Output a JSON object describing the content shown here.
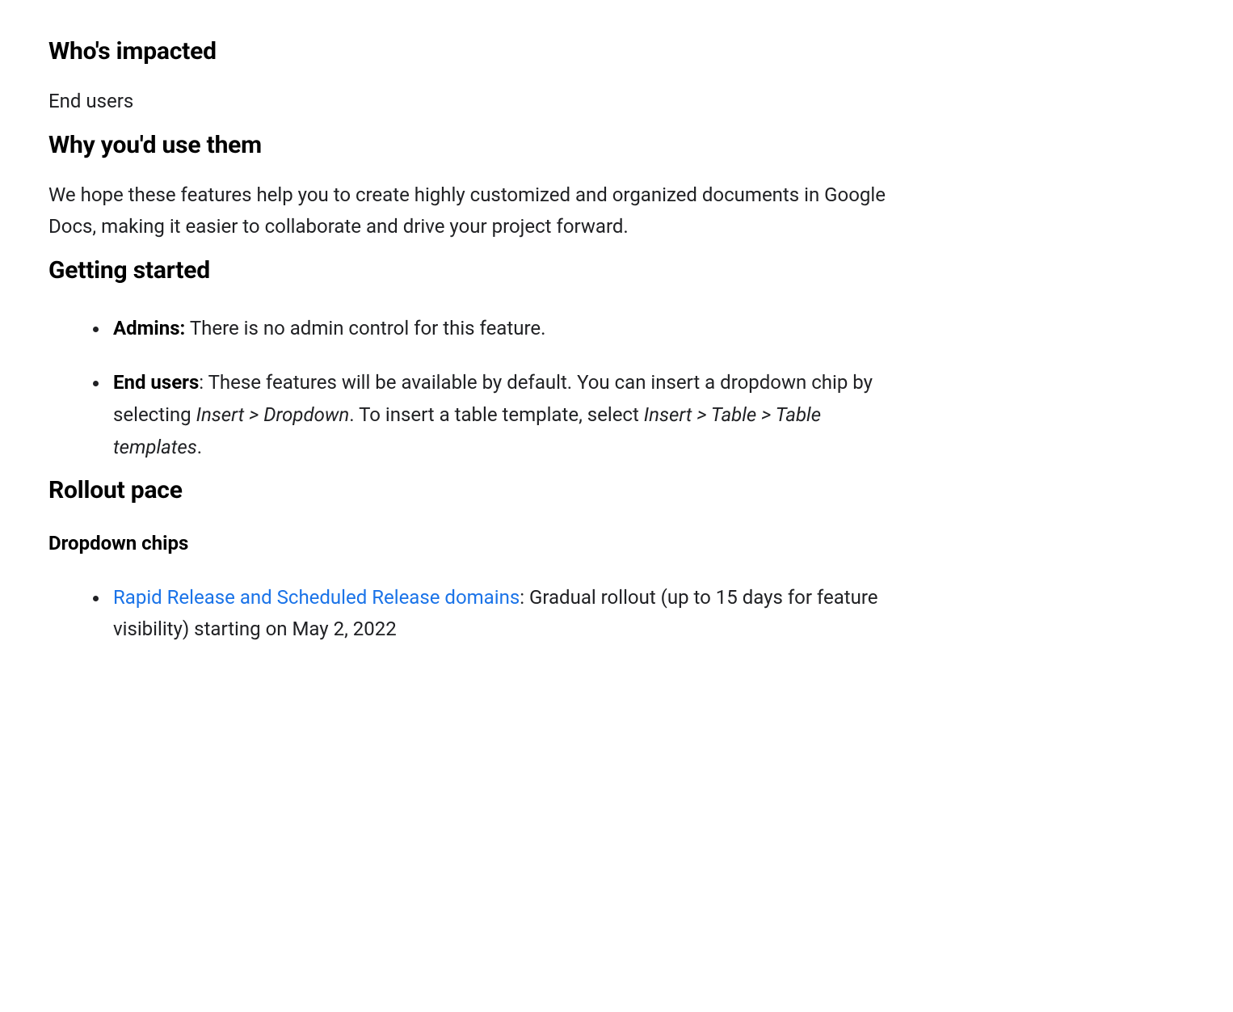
{
  "sections": {
    "whos_impacted": {
      "heading": "Who's impacted",
      "body": "End users"
    },
    "why_use": {
      "heading": "Why you'd use them",
      "body": "We hope these features help you to create highly customized and organized documents in Google Docs, making it easier to collaborate and drive your project forward."
    },
    "getting_started": {
      "heading": "Getting started",
      "items": {
        "admins": {
          "label": "Admins:",
          "text": " There is no admin control for this feature."
        },
        "end_users": {
          "label": "End users",
          "text_before_italic1": ": These features will be available by default. You can insert a dropdown chip by selecting ",
          "italic1": "Insert > Dropdown",
          "text_between": ". To insert a table template, select ",
          "italic2": "Insert > Table > Table templates",
          "text_after": "."
        }
      }
    },
    "rollout_pace": {
      "heading": "Rollout pace",
      "subheading": "Dropdown chips",
      "items": {
        "dropdown": {
          "link_text": "Rapid Release and Scheduled Release domains",
          "text": ": Gradual rollout (up to 15 days for feature visibility) starting on May 2, 2022"
        }
      }
    }
  }
}
